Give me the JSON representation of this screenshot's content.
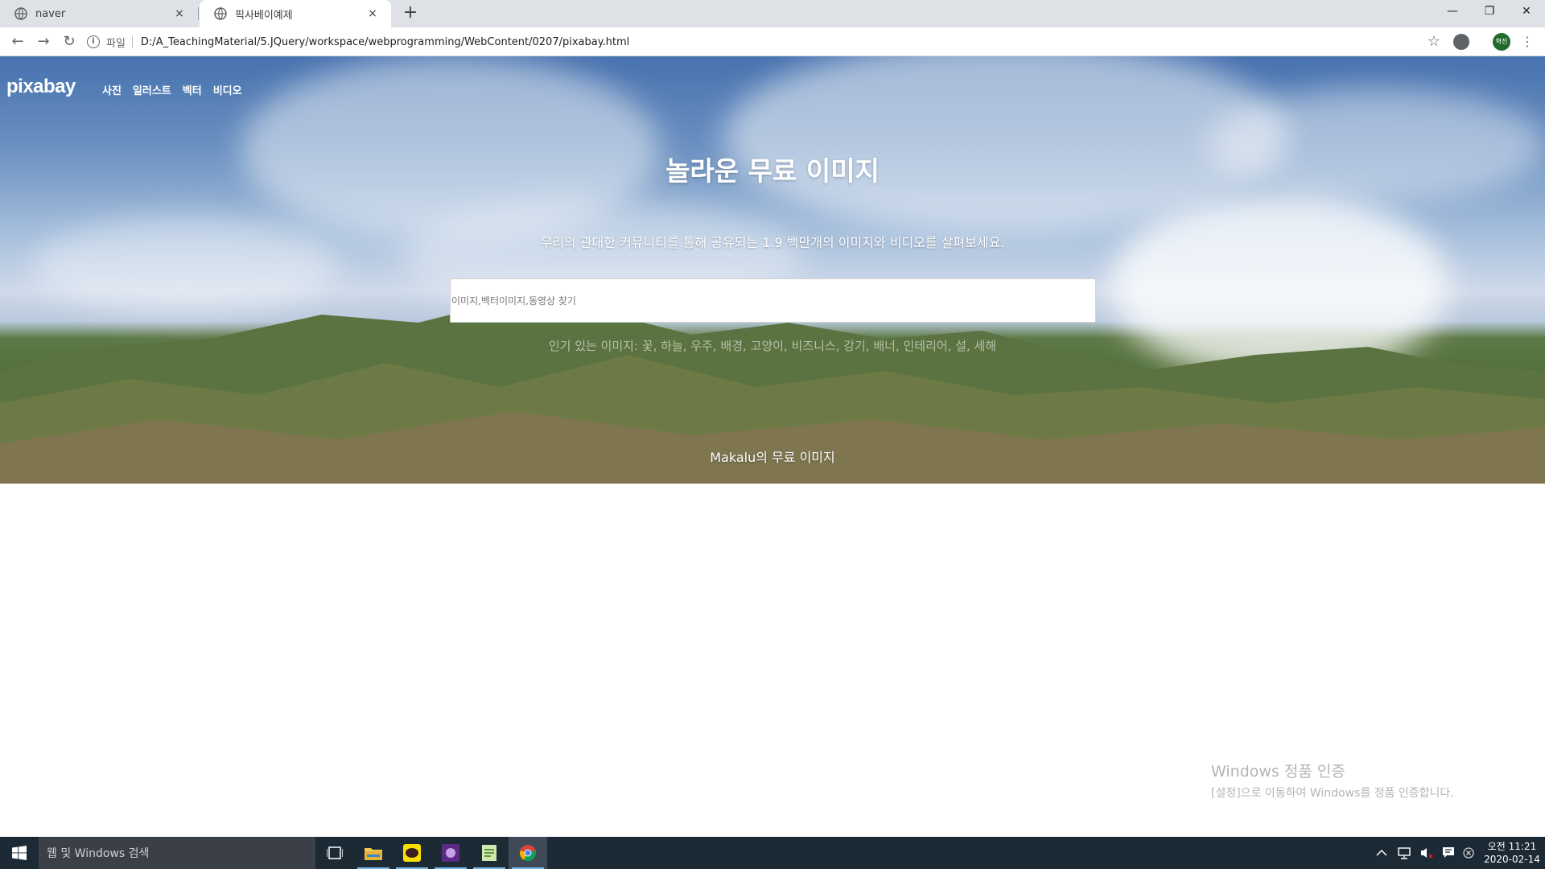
{
  "browser": {
    "tabs": [
      {
        "title": "naver",
        "close": "×"
      },
      {
        "title": "픽사베이예제",
        "close": "×"
      }
    ],
    "new_tab": "+",
    "address": {
      "scheme": "파일",
      "url": "D:/A_TeachingMaterial/5.JQuery/workspace/webprogramming/WebContent/0207/pixabay.html"
    },
    "profile_initials": "혁진",
    "window_controls": {
      "minimize": "—",
      "restore": "❐",
      "close": "✕"
    },
    "nav": {
      "back": "←",
      "forward": "→",
      "reload": "↻",
      "info": "i",
      "star": "☆",
      "menu": "⋮"
    }
  },
  "page": {
    "logo": "pixabay",
    "nav": [
      "사진",
      "일러스트",
      "벡터",
      "비디오"
    ],
    "title": "놀라운 무료 이미지",
    "subtitle": "우리의 관대한 커뮤니티를 통해 공유되는 1.9 백만개의 이미지와 비디오를 살펴보세요.",
    "search": {
      "placeholder": "이미지,벡터이미지,동영상 찾기"
    },
    "popular": "인기 있는 이미지: 꽃, 하늘, 우주, 배경, 고양이, 비즈니스, 강기, 배너, 인테리어, 설, 세해",
    "credit": "Makalu의 무료 이미지"
  },
  "watermark": {
    "line1": "Windows 정품 인증",
    "line2": "[설정]으로 이동하여 Windows를 정품 인증합니다."
  },
  "taskbar": {
    "search_placeholder": "웹 및 Windows 검색",
    "kakao_label": "TALK",
    "time": "오전 11:21",
    "date": "2020-02-14"
  }
}
